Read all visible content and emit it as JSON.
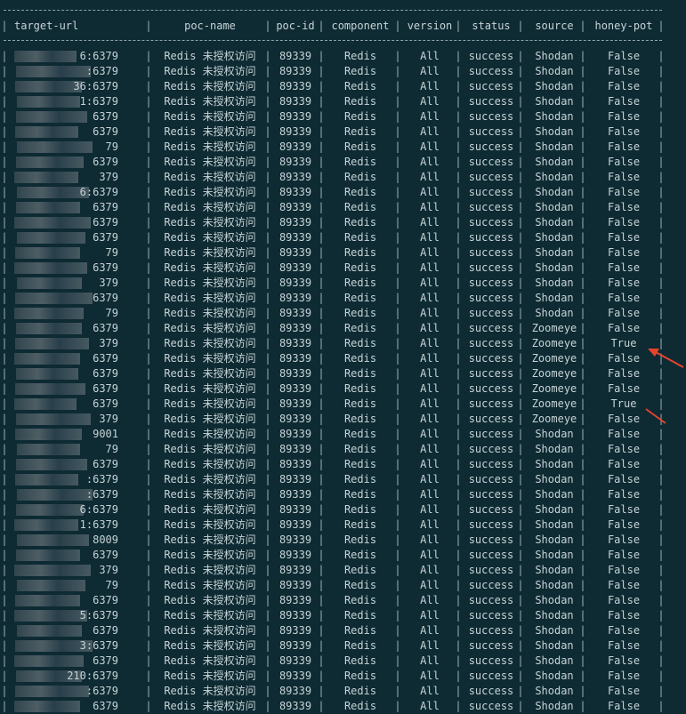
{
  "headers": [
    "target-url",
    "poc-name",
    "poc-id",
    "component",
    "version",
    "status",
    "source",
    "honey-pot"
  ],
  "rows": [
    {
      "url": "6:6379",
      "poc": "Redis 未授权访问",
      "id": "89339",
      "comp": "Redis",
      "ver": "All",
      "status": "success",
      "source": "Shodan",
      "honey": "False"
    },
    {
      "url": ":6379",
      "poc": "Redis 未授权访问",
      "id": "89339",
      "comp": "Redis",
      "ver": "All",
      "status": "success",
      "source": "Shodan",
      "honey": "False"
    },
    {
      "url": "36:6379",
      "poc": "Redis 未授权访问",
      "id": "89339",
      "comp": "Redis",
      "ver": "All",
      "status": "success",
      "source": "Shodan",
      "honey": "False"
    },
    {
      "url": "1:6379",
      "poc": "Redis 未授权访问",
      "id": "89339",
      "comp": "Redis",
      "ver": "All",
      "status": "success",
      "source": "Shodan",
      "honey": "False"
    },
    {
      "url": "6379",
      "poc": "Redis 未授权访问",
      "id": "89339",
      "comp": "Redis",
      "ver": "All",
      "status": "success",
      "source": "Shodan",
      "honey": "False"
    },
    {
      "url": "6379",
      "poc": "Redis 未授权访问",
      "id": "89339",
      "comp": "Redis",
      "ver": "All",
      "status": "success",
      "source": "Shodan",
      "honey": "False"
    },
    {
      "url": "79",
      "poc": "Redis 未授权访问",
      "id": "89339",
      "comp": "Redis",
      "ver": "All",
      "status": "success",
      "source": "Shodan",
      "honey": "False"
    },
    {
      "url": "6379",
      "poc": "Redis 未授权访问",
      "id": "89339",
      "comp": "Redis",
      "ver": "All",
      "status": "success",
      "source": "Shodan",
      "honey": "False"
    },
    {
      "url": "379",
      "poc": "Redis 未授权访问",
      "id": "89339",
      "comp": "Redis",
      "ver": "All",
      "status": "success",
      "source": "Shodan",
      "honey": "False"
    },
    {
      "url": "6:6379",
      "poc": "Redis 未授权访问",
      "id": "89339",
      "comp": "Redis",
      "ver": "All",
      "status": "success",
      "source": "Shodan",
      "honey": "False"
    },
    {
      "url": "6379",
      "poc": "Redis 未授权访问",
      "id": "89339",
      "comp": "Redis",
      "ver": "All",
      "status": "success",
      "source": "Shodan",
      "honey": "False"
    },
    {
      "url": "6379",
      "poc": "Redis 未授权访问",
      "id": "89339",
      "comp": "Redis",
      "ver": "All",
      "status": "success",
      "source": "Shodan",
      "honey": "False"
    },
    {
      "url": "6379",
      "poc": "Redis 未授权访问",
      "id": "89339",
      "comp": "Redis",
      "ver": "All",
      "status": "success",
      "source": "Shodan",
      "honey": "False"
    },
    {
      "url": "79",
      "poc": "Redis 未授权访问",
      "id": "89339",
      "comp": "Redis",
      "ver": "All",
      "status": "success",
      "source": "Shodan",
      "honey": "False"
    },
    {
      "url": "6379",
      "poc": "Redis 未授权访问",
      "id": "89339",
      "comp": "Redis",
      "ver": "All",
      "status": "success",
      "source": "Shodan",
      "honey": "False"
    },
    {
      "url": "379",
      "poc": "Redis 未授权访问",
      "id": "89339",
      "comp": "Redis",
      "ver": "All",
      "status": "success",
      "source": "Shodan",
      "honey": "False"
    },
    {
      "url": "6379",
      "poc": "Redis 未授权访问",
      "id": "89339",
      "comp": "Redis",
      "ver": "All",
      "status": "success",
      "source": "Shodan",
      "honey": "False"
    },
    {
      "url": "79",
      "poc": "Redis 未授权访问",
      "id": "89339",
      "comp": "Redis",
      "ver": "All",
      "status": "success",
      "source": "Shodan",
      "honey": "False"
    },
    {
      "url": "6379",
      "poc": "Redis 未授权访问",
      "id": "89339",
      "comp": "Redis",
      "ver": "All",
      "status": "success",
      "source": "Zoomeye",
      "honey": "False"
    },
    {
      "url": "379",
      "poc": "Redis 未授权访问",
      "id": "89339",
      "comp": "Redis",
      "ver": "All",
      "status": "success",
      "source": "Zoomeye",
      "honey": "True"
    },
    {
      "url": "6379",
      "poc": "Redis 未授权访问",
      "id": "89339",
      "comp": "Redis",
      "ver": "All",
      "status": "success",
      "source": "Zoomeye",
      "honey": "False"
    },
    {
      "url": "6379",
      "poc": "Redis 未授权访问",
      "id": "89339",
      "comp": "Redis",
      "ver": "All",
      "status": "success",
      "source": "Zoomeye",
      "honey": "False"
    },
    {
      "url": "6379",
      "poc": "Redis 未授权访问",
      "id": "89339",
      "comp": "Redis",
      "ver": "All",
      "status": "success",
      "source": "Zoomeye",
      "honey": "False"
    },
    {
      "url": "6379",
      "poc": "Redis 未授权访问",
      "id": "89339",
      "comp": "Redis",
      "ver": "All",
      "status": "success",
      "source": "Zoomeye",
      "honey": "True"
    },
    {
      "url": "379",
      "poc": "Redis 未授权访问",
      "id": "89339",
      "comp": "Redis",
      "ver": "All",
      "status": "success",
      "source": "Zoomeye",
      "honey": "False"
    },
    {
      "url": "9001",
      "poc": "Redis 未授权访问",
      "id": "89339",
      "comp": "Redis",
      "ver": "All",
      "status": "success",
      "source": "Shodan",
      "honey": "False"
    },
    {
      "url": "79",
      "poc": "Redis 未授权访问",
      "id": "89339",
      "comp": "Redis",
      "ver": "All",
      "status": "success",
      "source": "Shodan",
      "honey": "False"
    },
    {
      "url": "6379",
      "poc": "Redis 未授权访问",
      "id": "89339",
      "comp": "Redis",
      "ver": "All",
      "status": "success",
      "source": "Shodan",
      "honey": "False"
    },
    {
      "url": ":6379",
      "poc": "Redis 未授权访问",
      "id": "89339",
      "comp": "Redis",
      "ver": "All",
      "status": "success",
      "source": "Shodan",
      "honey": "False"
    },
    {
      "url": ":6379",
      "poc": "Redis 未授权访问",
      "id": "89339",
      "comp": "Redis",
      "ver": "All",
      "status": "success",
      "source": "Shodan",
      "honey": "False"
    },
    {
      "url": "6:6379",
      "poc": "Redis 未授权访问",
      "id": "89339",
      "comp": "Redis",
      "ver": "All",
      "status": "success",
      "source": "Shodan",
      "honey": "False"
    },
    {
      "url": "1:6379",
      "poc": "Redis 未授权访问",
      "id": "89339",
      "comp": "Redis",
      "ver": "All",
      "status": "success",
      "source": "Shodan",
      "honey": "False"
    },
    {
      "url": "8009",
      "poc": "Redis 未授权访问",
      "id": "89339",
      "comp": "Redis",
      "ver": "All",
      "status": "success",
      "source": "Shodan",
      "honey": "False"
    },
    {
      "url": "6379",
      "poc": "Redis 未授权访问",
      "id": "89339",
      "comp": "Redis",
      "ver": "All",
      "status": "success",
      "source": "Shodan",
      "honey": "False"
    },
    {
      "url": "379",
      "poc": "Redis 未授权访问",
      "id": "89339",
      "comp": "Redis",
      "ver": "All",
      "status": "success",
      "source": "Shodan",
      "honey": "False"
    },
    {
      "url": "79",
      "poc": "Redis 未授权访问",
      "id": "89339",
      "comp": "Redis",
      "ver": "All",
      "status": "success",
      "source": "Shodan",
      "honey": "False"
    },
    {
      "url": "6379",
      "poc": "Redis 未授权访问",
      "id": "89339",
      "comp": "Redis",
      "ver": "All",
      "status": "success",
      "source": "Shodan",
      "honey": "False"
    },
    {
      "url": "5:6379",
      "poc": "Redis 未授权访问",
      "id": "89339",
      "comp": "Redis",
      "ver": "All",
      "status": "success",
      "source": "Shodan",
      "honey": "False"
    },
    {
      "url": "6379",
      "poc": "Redis 未授权访问",
      "id": "89339",
      "comp": "Redis",
      "ver": "All",
      "status": "success",
      "source": "Shodan",
      "honey": "False"
    },
    {
      "url": "3:6379",
      "poc": "Redis 未授权访问",
      "id": "89339",
      "comp": "Redis",
      "ver": "All",
      "status": "success",
      "source": "Shodan",
      "honey": "False"
    },
    {
      "url": "6379",
      "poc": "Redis 未授权访问",
      "id": "89339",
      "comp": "Redis",
      "ver": "All",
      "status": "success",
      "source": "Shodan",
      "honey": "False"
    },
    {
      "url": "210:6379",
      "poc": "Redis 未授权访问",
      "id": "89339",
      "comp": "Redis",
      "ver": "All",
      "status": "success",
      "source": "Shodan",
      "honey": "False"
    },
    {
      "url": ":6379",
      "poc": "Redis 未授权访问",
      "id": "89339",
      "comp": "Redis",
      "ver": "All",
      "status": "success",
      "source": "Shodan",
      "honey": "False"
    },
    {
      "url": "6379",
      "poc": "Redis 未授权访问",
      "id": "89339",
      "comp": "Redis",
      "ver": "All",
      "status": "success",
      "source": "Shodan",
      "honey": "False"
    }
  ],
  "colors": {
    "background": "#0e2a33",
    "text": "#c6d4d6",
    "arrow": "#e8442c"
  }
}
